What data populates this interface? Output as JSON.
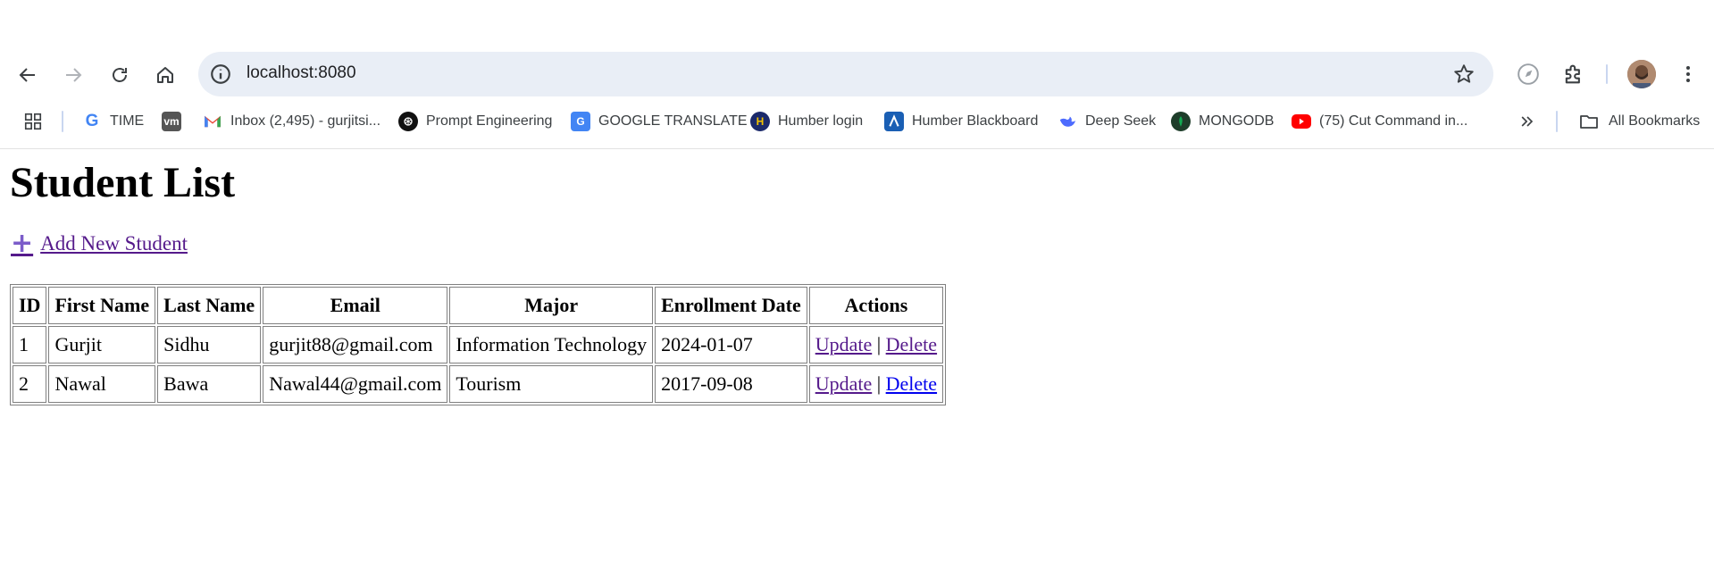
{
  "browser": {
    "url": "localhost:8080",
    "bookmarks": [
      {
        "label": "TIME",
        "icon": "google-icon",
        "color": "#4285f4"
      },
      {
        "label": "",
        "icon": "vm-icon",
        "color": "#555555"
      },
      {
        "label": "Inbox (2,495) - gurjitsi...",
        "icon": "gmail-icon",
        "color": "#ea4335"
      },
      {
        "label": "Prompt Engineering",
        "icon": "openai-icon",
        "color": "#111111"
      },
      {
        "label": "GOOGLE TRANSLATE",
        "icon": "translate-icon",
        "color": "#4285f4"
      },
      {
        "label": "Humber login",
        "icon": "humber-icon",
        "color": "#1b2a6b"
      },
      {
        "label": "Humber Blackboard",
        "icon": "blackboard-icon",
        "color": "#1a5fb4"
      },
      {
        "label": "Deep Seek",
        "icon": "deepseek-icon",
        "color": "#4d6bfe"
      },
      {
        "label": "MONGODB",
        "icon": "mongodb-icon",
        "color": "#1e3d2a"
      },
      {
        "label": "(75) Cut Command in...",
        "icon": "youtube-icon",
        "color": "#ff0000"
      }
    ],
    "all_bookmarks_label": "All Bookmarks",
    "vm_text": "vm"
  },
  "page": {
    "title": "Student List",
    "add_link": "Add New Student"
  },
  "table": {
    "headers": [
      "ID",
      "First Name",
      "Last Name",
      "Email",
      "Major",
      "Enrollment Date",
      "Actions"
    ],
    "rows": [
      {
        "id": "1",
        "first": "Gurjit",
        "last": "Sidhu",
        "email": "gurjit88@gmail.com",
        "major": "Information Technology",
        "date": "2024-01-07"
      },
      {
        "id": "2",
        "first": "Nawal",
        "last": "Bawa",
        "email": "Nawal44@gmail.com",
        "major": "Tourism",
        "date": "2017-09-08"
      }
    ],
    "update_label": "Update",
    "delete_label": "Delete",
    "separator": "|"
  }
}
